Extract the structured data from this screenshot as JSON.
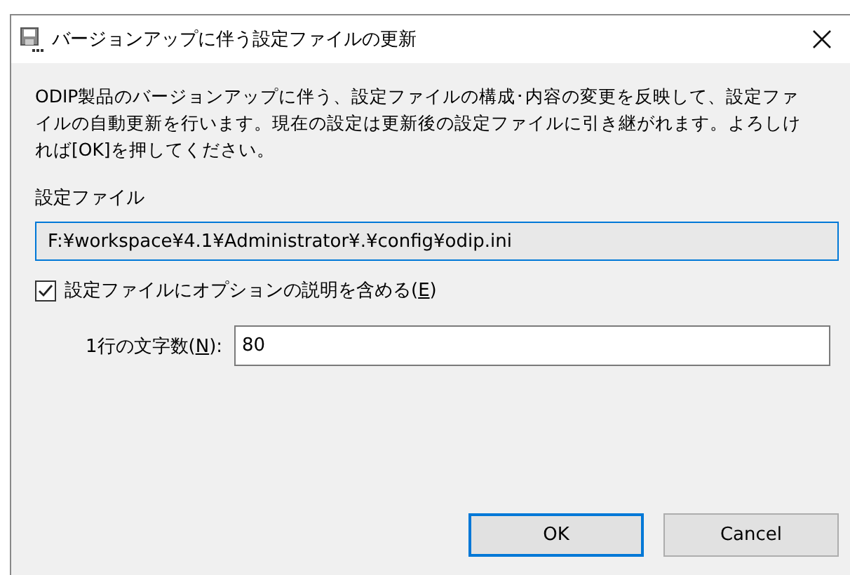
{
  "window": {
    "title": "バージョンアップに伴う設定ファイルの更新"
  },
  "description": "ODIP製品のバージョンアップに伴う、設定ファイルの構成･内容の変更を反映して、設定ファイルの自動更新を行います。現在の設定は更新後の設定ファイルに引き継がれます。よろしければ[OK]を押してください。",
  "file_label": "設定ファイル",
  "file_path": {
    "value": "F:¥workspace¥4.1¥Administrator¥.¥config¥odip.ini",
    "disabled": true
  },
  "include_descriptions": {
    "label_before": "設定ファイルにオプションの説明を含める(",
    "access_key": "E",
    "label_after": ")",
    "checked": true
  },
  "line_width": {
    "label_before": "1行の文字数(",
    "access_key": "N",
    "label_after": "):",
    "value": "80"
  },
  "buttons": [
    {
      "label": "OK",
      "default": true
    },
    {
      "label": "Cancel",
      "default": false
    }
  ]
}
